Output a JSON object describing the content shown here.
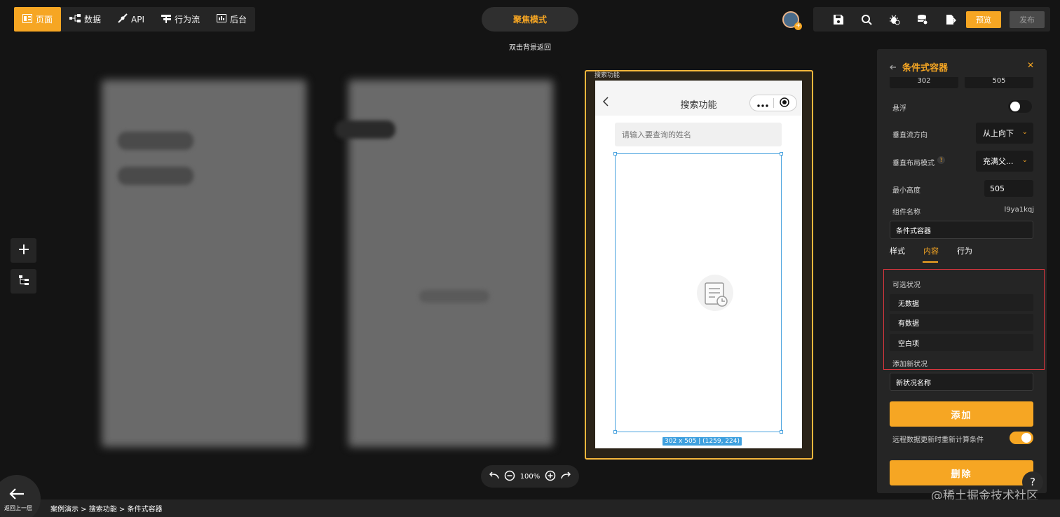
{
  "top_nav": {
    "items": [
      {
        "label": "页面",
        "icon": "page-icon",
        "active": true
      },
      {
        "label": "数据",
        "icon": "data-icon",
        "active": false
      },
      {
        "label": "API",
        "icon": "api-icon",
        "active": false
      },
      {
        "label": "行为流",
        "icon": "flow-icon",
        "active": false
      },
      {
        "label": "后台",
        "icon": "backend-icon",
        "active": false
      }
    ]
  },
  "focus_mode": {
    "label": "聚焦模式",
    "hint": "双击背景返回"
  },
  "toolbar": {
    "icons": [
      "save-icon",
      "search-icon",
      "debug-icon",
      "database-check-icon",
      "export-icon"
    ],
    "preview_label": "预览",
    "publish_label": "发布"
  },
  "canvas": {
    "frame_label": "搜索功能",
    "phone": {
      "title": "搜索功能",
      "search_placeholder": "请输入要查询的姓名"
    },
    "selection_info": "302 x 505 | (1259, 224)",
    "zoom": "100%"
  },
  "panel": {
    "title": "条件式容器",
    "width_value": "302",
    "height_value": "505",
    "float_label": "悬浮",
    "vertical_flow_label": "垂直流方向",
    "vertical_flow_value": "从上向下",
    "vertical_layout_label": "垂直布局模式",
    "vertical_layout_value": "充满父...",
    "min_height_label": "最小高度",
    "min_height_value": "505",
    "component_name_label": "组件名称",
    "component_id": "l9ya1kqj",
    "component_name_value": "条件式容器",
    "tabs": [
      "样式",
      "内容",
      "行为"
    ],
    "active_tab": "内容",
    "optional_states_label": "可选状况",
    "states": [
      "无数据",
      "有数据",
      "空白项"
    ],
    "add_state_label": "添加新状况",
    "new_state_placeholder": "新状况名称",
    "add_button": "添加",
    "remote_recompute_label": "远程数据更新时重新计算条件",
    "delete_button": "删除"
  },
  "bottom": {
    "back_label": "返回上一层",
    "breadcrumb": "案例演示 > 搜索功能 > 条件式容器"
  },
  "watermark": "@稀土掘金技术社区",
  "colors": {
    "accent": "#f6a623",
    "selection": "#4aa3df",
    "highlight_box": "#d9363e"
  }
}
